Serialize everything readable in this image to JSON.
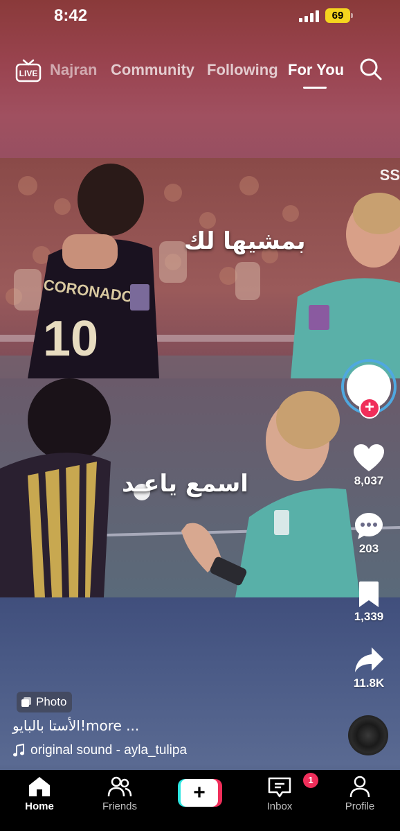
{
  "status_bar": {
    "time": "8:42",
    "battery": "69"
  },
  "top_nav": {
    "live_label": "LIVE",
    "tabs": [
      {
        "label": "Najran"
      },
      {
        "label": "Community"
      },
      {
        "label": "Following"
      },
      {
        "label": "For You",
        "active": true
      }
    ]
  },
  "post": {
    "overlay_top": "بمشيها لك",
    "overlay_bottom": "اسمع ياعـد",
    "watermark": "SS",
    "jersey_name": "CORONADO",
    "jersey_number": "10",
    "photo_badge": "Photo",
    "caption": "الأستا بالبايو!more ...",
    "sound": "original sound - ayla_tulipa"
  },
  "actions": {
    "likes": "8,037",
    "comments": "203",
    "saves": "1,339",
    "shares": "11.8K"
  },
  "tab_bar": {
    "home": "Home",
    "friends": "Friends",
    "inbox": "Inbox",
    "inbox_badge": "1",
    "profile": "Profile"
  },
  "colors": {
    "accent_pink": "#f02e5a",
    "accent_cyan": "#2ce5e0",
    "battery_yellow": "#f5d51e",
    "avatar_ring": "#4fa8e0"
  }
}
